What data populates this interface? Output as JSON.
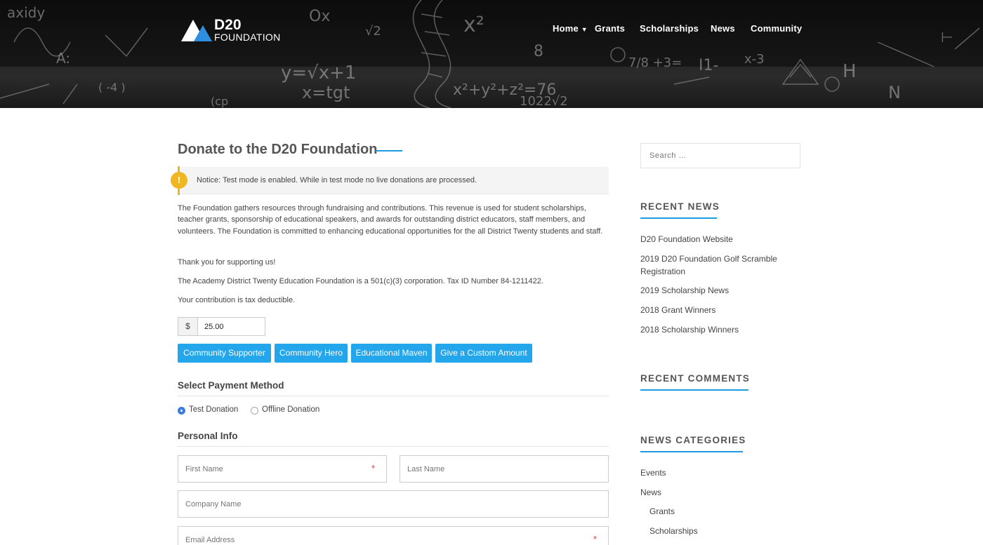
{
  "brand": {
    "line1": "D20",
    "line2": "FOUNDATION"
  },
  "nav": [
    {
      "label": "Home",
      "has_dropdown": true
    },
    {
      "label": "Grants"
    },
    {
      "label": "Scholarships"
    },
    {
      "label": "News"
    },
    {
      "label": "Community"
    }
  ],
  "page": {
    "title": "Donate to the D20 Foundation",
    "notice": "Notice: Test mode is enabled. While in test mode no live donations are processed.",
    "paragraphs": [
      "The Foundation gathers resources through fundraising and contributions. This revenue is used for student scholarships, teacher grants, sponsorship of educational speakers, and awards for outstanding district educators, staff members, and volunteers.  The Foundation is committed to enhancing educational opportunities for the all District Twenty students and staff.",
      "Thank you for supporting us!",
      "The Academy District Twenty Education Foundation is a 501(c)(3) corporation. Tax ID Number 84-1211422.",
      "Your contribution is tax deductible."
    ]
  },
  "donation": {
    "currency_symbol": "$",
    "amount": "25.00",
    "levels": [
      "Community Supporter",
      "Community Hero",
      "Educational Maven",
      "Give a Custom Amount"
    ]
  },
  "payment": {
    "title": "Select Payment Method",
    "options": [
      {
        "label": "Test Donation",
        "selected": true
      },
      {
        "label": "Offline Donation",
        "selected": false
      }
    ]
  },
  "personal": {
    "title": "Personal Info",
    "first_name_placeholder": "First Name",
    "last_name_placeholder": "Last Name",
    "company_placeholder": "Company Name",
    "email_placeholder": "Email Address",
    "required_mark": "*"
  },
  "sidebar": {
    "search_placeholder": "Search …",
    "recent_news": {
      "title": "RECENT NEWS",
      "items": [
        "D20 Foundation Website",
        "2019 D20 Foundation Golf Scramble Registration",
        "2019 Scholarship News",
        "2018 Grant Winners",
        "2018 Scholarship Winners"
      ]
    },
    "recent_comments": {
      "title": "RECENT COMMENTS"
    },
    "categories": {
      "title": "NEWS CATEGORIES",
      "items": [
        {
          "label": "Events",
          "child": false
        },
        {
          "label": "News",
          "child": false
        },
        {
          "label": "Grants",
          "child": true
        },
        {
          "label": "Scholarships",
          "child": true
        }
      ]
    }
  },
  "colors": {
    "accent": "#23a6eb",
    "notice": "#f0b722",
    "required": "#e23c3c"
  }
}
